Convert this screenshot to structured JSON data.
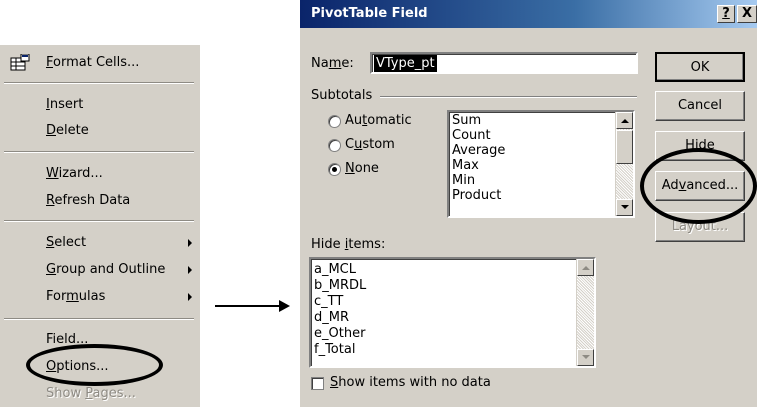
{
  "context_menu": {
    "format_cells": {
      "pre": "",
      "ul": "F",
      "post": "ormat Cells..."
    },
    "insert": {
      "pre": "",
      "ul": "I",
      "post": "nsert"
    },
    "delete": {
      "pre": "",
      "ul": "D",
      "post": "elete"
    },
    "wizard": {
      "pre": "",
      "ul": "W",
      "post": "izard..."
    },
    "refresh": {
      "pre": "",
      "ul": "R",
      "post": "efresh Data"
    },
    "select": {
      "pre": "",
      "ul": "S",
      "post": "elect"
    },
    "group": {
      "pre": "",
      "ul": "G",
      "post": "roup and Outline"
    },
    "formulas": {
      "pre": "For",
      "ul": "m",
      "post": "ulas"
    },
    "field": "Field...",
    "options": {
      "pre": "",
      "ul": "O",
      "post": "ptions..."
    },
    "show_pages": {
      "pre": "Show ",
      "ul": "P",
      "post": "ages..."
    }
  },
  "dialog": {
    "title": "PivotTable Field",
    "help_button": "?",
    "close_button": "X",
    "name_label": {
      "pre": "Na",
      "ul": "m",
      "post": "e:"
    },
    "name_value": "VType_pt",
    "subtotals_label": "Subtotals",
    "radio_automatic": {
      "pre": "Au",
      "ul": "t",
      "post": "omatic"
    },
    "radio_custom": {
      "pre": "C",
      "ul": "u",
      "post": "stom"
    },
    "radio_none": {
      "pre": "",
      "ul": "N",
      "post": "one"
    },
    "selected_radio": "None",
    "subtotal_functions": [
      "Sum",
      "Count",
      "Average",
      "Max",
      "Min",
      "Product"
    ],
    "hide_items_label": {
      "pre": "Hide ",
      "ul": "i",
      "post": "tems:"
    },
    "hide_items": [
      "a_MCL",
      "b_MRDL",
      "c_TT",
      "d_MR",
      "e_Other",
      "f_Total"
    ],
    "show_items_checkbox": {
      "pre": "",
      "ul": "S",
      "post": "how items with no data"
    },
    "show_items_checked": false,
    "ok_button": "OK",
    "cancel_button": "Cancel",
    "hide_button": "Hide",
    "advanced_button": {
      "pre": "Ad",
      "ul": "v",
      "post": "anced..."
    },
    "layout_button": "Layout..."
  },
  "colors": {
    "titlebar_start": "#0a246a",
    "titlebar_end": "#a6caf0",
    "face": "#d4d0c8",
    "highlight_ellipse": "#000000"
  }
}
